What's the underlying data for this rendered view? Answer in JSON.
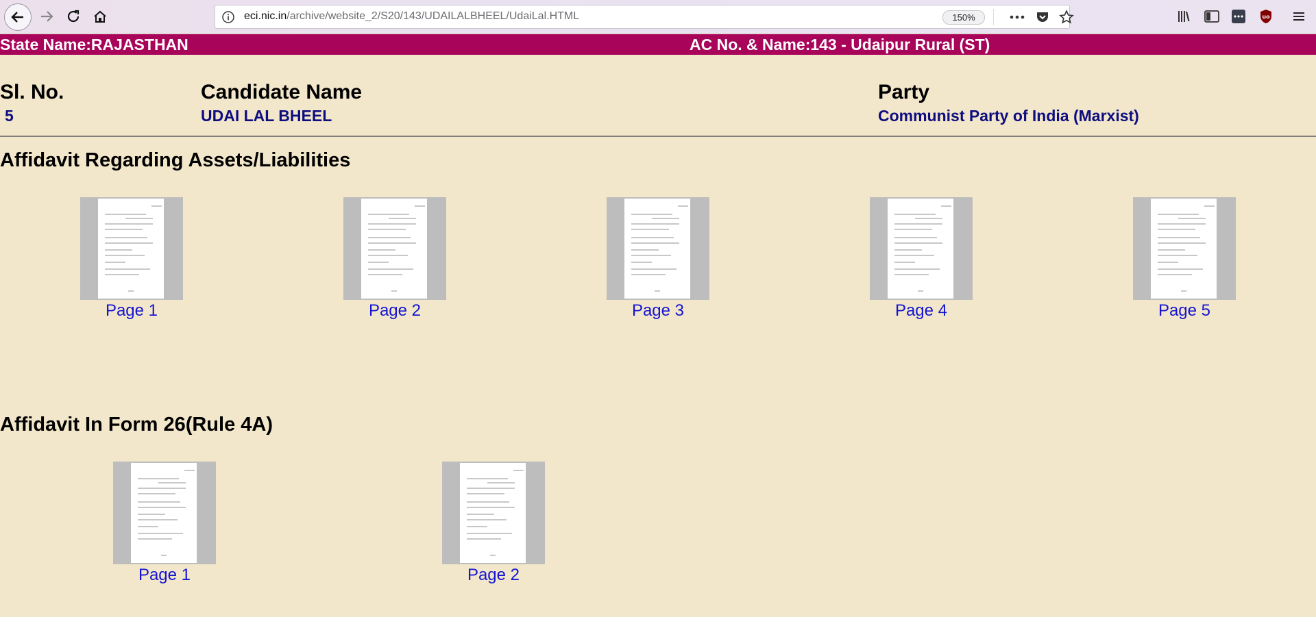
{
  "browser": {
    "url_host": "eci.nic.in",
    "url_path": "/archive/website_2/S20/143/UDAILALBHEEL/UdaiLal.HTML",
    "zoom": "150%"
  },
  "header": {
    "state_name": "State Name:RAJASTHAN",
    "ac_name": "AC No. & Name:143 - Udaipur Rural (ST)"
  },
  "candidate": {
    "sl_no_label": "Sl. No.",
    "sl_no_value": "5",
    "name_label": "Candidate Name",
    "name_value": "UDAI LAL BHEEL",
    "party_label": "Party",
    "party_value": "Communist Party of India (Marxist)"
  },
  "sections": [
    {
      "title": "Affidavit Regarding Assets/Liabilities",
      "pages": [
        "Page 1",
        "Page 2",
        "Page 3",
        "Page 4",
        "Page 5"
      ]
    },
    {
      "title": "Affidavit In Form 26(Rule 4A)",
      "pages": [
        "Page 1",
        "Page 2"
      ]
    }
  ],
  "colors": {
    "header_bg": "#a8045a",
    "page_bg": "#f3e7cb",
    "link": "#1414d2",
    "value_text": "#0d0d80"
  }
}
